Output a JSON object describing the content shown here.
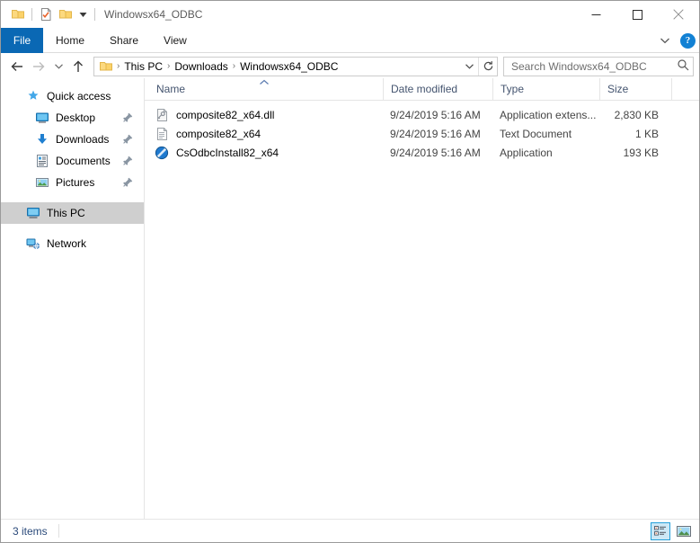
{
  "window": {
    "title": "Windowsx64_ODBC",
    "quick_access": [
      {
        "name": "folder-icon",
        "label": "Folder"
      },
      {
        "name": "properties-icon",
        "label": "Properties"
      },
      {
        "name": "new-folder-icon",
        "label": "New folder"
      },
      {
        "name": "chevron-down-icon",
        "label": "Customize Quick Access Toolbar"
      }
    ],
    "controls": {
      "minimize": "Minimize",
      "maximize": "Maximize",
      "close": "Close"
    }
  },
  "ribbon": {
    "tabs": [
      {
        "label": "File",
        "active": true
      },
      {
        "label": "Home",
        "active": false
      },
      {
        "label": "Share",
        "active": false
      },
      {
        "label": "View",
        "active": false
      }
    ],
    "collapse_label": "Minimize the Ribbon",
    "help_label": "?"
  },
  "navigation": {
    "back_label": "Back",
    "forward_label": "Forward",
    "recent_label": "Recent locations",
    "up_label": "Up to This PC",
    "breadcrumbs": [
      {
        "label": "This PC"
      },
      {
        "label": "Downloads"
      },
      {
        "label": "Windowsx64_ODBC"
      }
    ],
    "separator": "›",
    "dropdown_label": "Previous locations",
    "refresh_label": "Refresh"
  },
  "search": {
    "placeholder": "Search Windowsx64_ODBC",
    "value": "",
    "icon_label": "search-icon"
  },
  "sidebar": {
    "items": [
      {
        "label": "Quick access",
        "icon": "star-icon",
        "level": "root",
        "pinned": false,
        "selected": false
      },
      {
        "label": "Desktop",
        "icon": "desktop-icon",
        "level": "child",
        "pinned": true,
        "selected": false
      },
      {
        "label": "Downloads",
        "icon": "download-icon",
        "level": "child",
        "pinned": true,
        "selected": false
      },
      {
        "label": "Documents",
        "icon": "documents-icon",
        "level": "child",
        "pinned": true,
        "selected": false
      },
      {
        "label": "Pictures",
        "icon": "pictures-icon",
        "level": "child",
        "pinned": true,
        "selected": false
      },
      {
        "label": "This PC",
        "icon": "pc-icon",
        "level": "root",
        "pinned": false,
        "selected": true
      },
      {
        "label": "Network",
        "icon": "network-icon",
        "level": "root",
        "pinned": false,
        "selected": false
      }
    ]
  },
  "filelist": {
    "columns": [
      {
        "key": "name",
        "label": "Name",
        "sorted": "asc"
      },
      {
        "key": "date",
        "label": "Date modified",
        "sorted": ""
      },
      {
        "key": "type",
        "label": "Type",
        "sorted": ""
      },
      {
        "key": "size",
        "label": "Size",
        "sorted": ""
      }
    ],
    "rows": [
      {
        "icon": "dll-file-icon",
        "name": "composite82_x64.dll",
        "date": "9/24/2019 5:16 AM",
        "type": "Application extens...",
        "size": "2,830 KB"
      },
      {
        "icon": "text-document-icon",
        "name": "composite82_x64",
        "date": "9/24/2019 5:16 AM",
        "type": "Text Document",
        "size": "1 KB"
      },
      {
        "icon": "application-disc-icon",
        "name": "CsOdbcInstall82_x64",
        "date": "9/24/2019 5:16 AM",
        "type": "Application",
        "size": "193 KB"
      }
    ]
  },
  "statusbar": {
    "item_count": "3 items",
    "details_view_label": "Details view",
    "icons_view_label": "Large icons view"
  },
  "colors": {
    "accent": "#0a68b4",
    "help_blue": "#1281d4",
    "selection": "#cfcfcf",
    "view_active_border": "#26a0da",
    "header_text": "#44546f",
    "folder_yellow": "#fcd97f"
  }
}
